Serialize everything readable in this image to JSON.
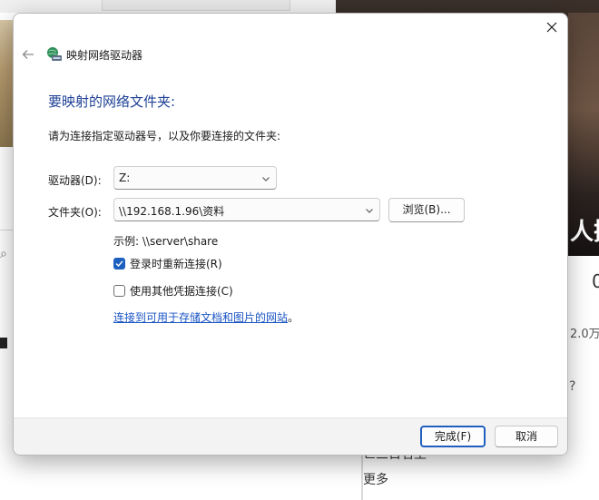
{
  "dialog": {
    "title": "映射网络驱动器",
    "heading": "要映射的网络文件夹:",
    "instruction": "请为连接指定驱动器号，以及你要连接的文件夹:",
    "drive": {
      "label": "驱动器(D):",
      "value": "Z:"
    },
    "folder": {
      "label": "文件夹(O):",
      "value": "\\\\192.168.1.96\\资料"
    },
    "browse_button": "浏览(B)...",
    "example": "示例: \\\\server\\share",
    "reconnect_checkbox": {
      "label": "登录时重新连接(R)",
      "checked": true
    },
    "other_credentials_checkbox": {
      "label": "使用其他凭据连接(C)",
      "checked": false
    },
    "link": {
      "text": "连接到可用于存储文档和图片的网站",
      "period": "。"
    },
    "finish_button": "完成(F)",
    "cancel_button": "取消"
  },
  "background": {
    "caption": "人捌",
    "number": "0",
    "count": "2.0万",
    "question": "?",
    "bottom_text_1": "世三百名王",
    "bottom_text_2": "更多"
  },
  "colors": {
    "accent": "#1d5fbf",
    "heading": "#1c3f94",
    "link": "#1a55c4",
    "footer": "#f3f3f3"
  }
}
